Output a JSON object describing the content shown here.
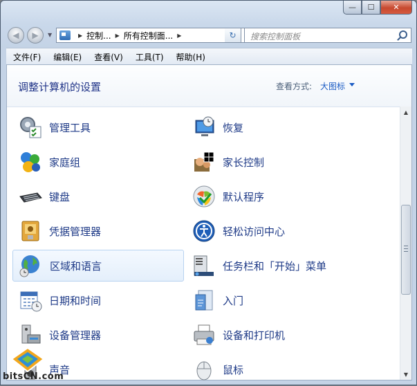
{
  "window": {
    "caption_buttons": [
      "—",
      "☐",
      "✕"
    ]
  },
  "nav": {
    "back_glyph": "◀",
    "forward_glyph": "▶"
  },
  "address": {
    "crumbs": [
      "控制...",
      "所有控制面..."
    ]
  },
  "search": {
    "placeholder": "搜索控制面板"
  },
  "menu": [
    "文件(F)",
    "编辑(E)",
    "查看(V)",
    "工具(T)",
    "帮助(H)"
  ],
  "header": {
    "title": "调整计算机的设置",
    "view_by_label": "查看方式:",
    "view_by_value": "大图标"
  },
  "items_left": [
    "管理工具",
    "家庭组",
    "键盘",
    "凭据管理器",
    "区域和语言",
    "日期和时间",
    "设备管理器",
    "声音"
  ],
  "items_right": [
    "恢复",
    "家长控制",
    "默认程序",
    "轻松访问中心",
    "任务栏和「开始」菜单",
    "入门",
    "设备和打印机",
    "鼠标"
  ],
  "selected_item": "区域和语言",
  "watermark": {
    "text": "bitsCN.com"
  },
  "colors": {
    "accent": "#1e3a87",
    "title": "#1e3287",
    "link": "#1a5bc4"
  }
}
